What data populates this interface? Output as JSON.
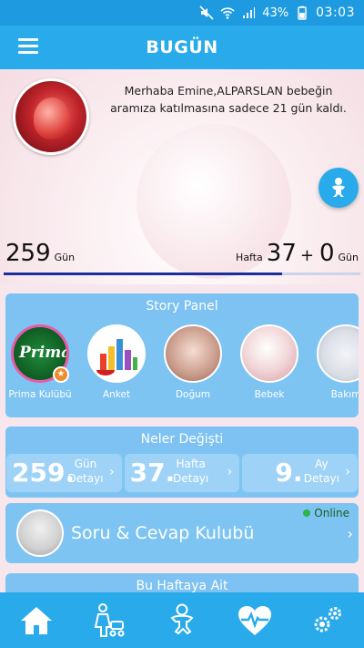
{
  "status_bar": {
    "battery": "43%",
    "time": "03:03"
  },
  "app_bar": {
    "title": "BUGÜN"
  },
  "hero": {
    "welcome": "Merhaba Emine,ALPARSLAN bebeğin aramıza katılmasına sadece 21 gün kaldı.",
    "days_count": "259",
    "days_unit": "Gün",
    "week_label": "Hafta",
    "week_value": "37",
    "plus": "+",
    "week_days_value": "0",
    "week_days_unit": "Gün"
  },
  "story_panel": {
    "title": "Story Panel",
    "items": [
      {
        "label": "Prima Kulübü",
        "logo_text": "Prima"
      },
      {
        "label": "Anket"
      },
      {
        "label": "Doğum"
      },
      {
        "label": "Bebek"
      },
      {
        "label": "Bakım"
      }
    ]
  },
  "neler_degisti": {
    "title": "Neler Değişti",
    "details": [
      {
        "number": "259.",
        "label_top": "Gün",
        "label_bottom": "Detayı"
      },
      {
        "number": "37.",
        "label_top": "Hafta",
        "label_bottom": "Detayı"
      },
      {
        "number": "9.",
        "label_top": "Ay",
        "label_bottom": "Detayı"
      }
    ]
  },
  "soru_cevap": {
    "title": "Soru & Cevap Kulubü",
    "status": "Online"
  },
  "bu_hafta": {
    "title": "Bu Haftaya Ait"
  },
  "colors": {
    "primary": "#29aaea",
    "status_bar": "#1e9be0",
    "card": "#7ec4f3",
    "progress": "#1a2f9c",
    "online": "#2db34a"
  },
  "bottom_nav": [
    {
      "icon": "home-icon"
    },
    {
      "icon": "mother-stroller-icon"
    },
    {
      "icon": "baby-icon"
    },
    {
      "icon": "heartbeat-icon"
    },
    {
      "icon": "settings-gears-icon"
    }
  ]
}
